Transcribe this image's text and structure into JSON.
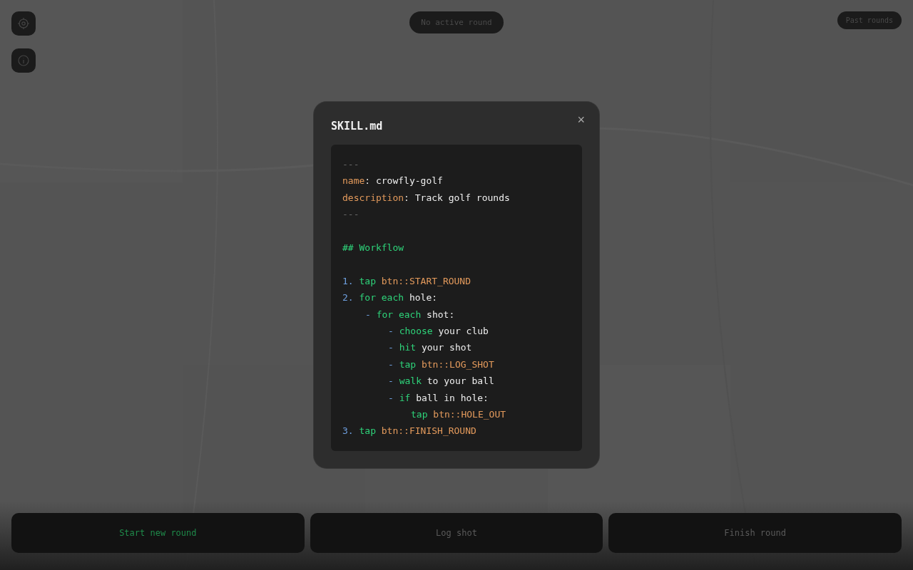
{
  "toolbar": [
    {
      "kind": "locate"
    },
    {
      "kind": "info"
    }
  ],
  "status_pill": "No active round",
  "past_rounds_button": "Past rounds",
  "modal": {
    "title": "SKILL.md",
    "close": "×",
    "front_matter": {
      "open": "---",
      "fields": [
        {
          "key": "name",
          "sep": ":",
          "value": "crowfly-golf"
        },
        {
          "key": "description",
          "sep": ":",
          "value": "Track golf rounds"
        }
      ],
      "close": "---"
    },
    "heading": "## Workflow",
    "steps": [
      {
        "tokens": [
          {
            "kind": "num",
            "text": "1."
          },
          {
            "kind": "keyword",
            "text": "tap"
          },
          {
            "kind": "ref",
            "text": "btn::START_ROUND"
          }
        ]
      },
      {
        "tokens": [
          {
            "kind": "num",
            "text": "2."
          },
          {
            "kind": "keyword",
            "text": "for each"
          },
          {
            "kind": "plain",
            "text": "hole:"
          }
        ],
        "children": [
          {
            "tokens": [
              {
                "kind": "bullet",
                "text": "-"
              },
              {
                "kind": "keyword",
                "text": "for each"
              },
              {
                "kind": "plain",
                "text": "shot:"
              }
            ],
            "children": [
              {
                "tokens": [
                  {
                    "kind": "bullet",
                    "text": "-"
                  },
                  {
                    "kind": "keyword",
                    "text": "choose"
                  },
                  {
                    "kind": "plain",
                    "text": "your club"
                  }
                ]
              },
              {
                "tokens": [
                  {
                    "kind": "bullet",
                    "text": "-"
                  },
                  {
                    "kind": "keyword",
                    "text": "hit"
                  },
                  {
                    "kind": "plain",
                    "text": "your shot"
                  }
                ]
              },
              {
                "tokens": [
                  {
                    "kind": "bullet",
                    "text": "-"
                  },
                  {
                    "kind": "keyword",
                    "text": "tap"
                  },
                  {
                    "kind": "ref",
                    "text": "btn::LOG_SHOT"
                  }
                ]
              },
              {
                "tokens": [
                  {
                    "kind": "bullet",
                    "text": "-"
                  },
                  {
                    "kind": "keyword",
                    "text": "walk"
                  },
                  {
                    "kind": "plain",
                    "text": "to your ball"
                  }
                ]
              },
              {
                "tokens": [
                  {
                    "kind": "bullet",
                    "text": "-"
                  },
                  {
                    "kind": "keyword",
                    "text": "if"
                  },
                  {
                    "kind": "plain",
                    "text": "ball in hole:"
                  }
                ],
                "children": [
                  {
                    "tokens": [
                      {
                        "kind": "keyword",
                        "text": "tap"
                      },
                      {
                        "kind": "ref",
                        "text": "btn::HOLE_OUT"
                      }
                    ]
                  }
                ]
              }
            ]
          }
        ]
      },
      {
        "tokens": [
          {
            "kind": "num",
            "text": "3."
          },
          {
            "kind": "keyword",
            "text": "tap"
          },
          {
            "kind": "ref",
            "text": "btn::FINISH_ROUND"
          }
        ]
      }
    ]
  },
  "actions": [
    {
      "label": "Start new round",
      "disabled": false
    },
    {
      "label": "Log shot",
      "disabled": true
    },
    {
      "label": "Finish round",
      "disabled": true
    }
  ]
}
